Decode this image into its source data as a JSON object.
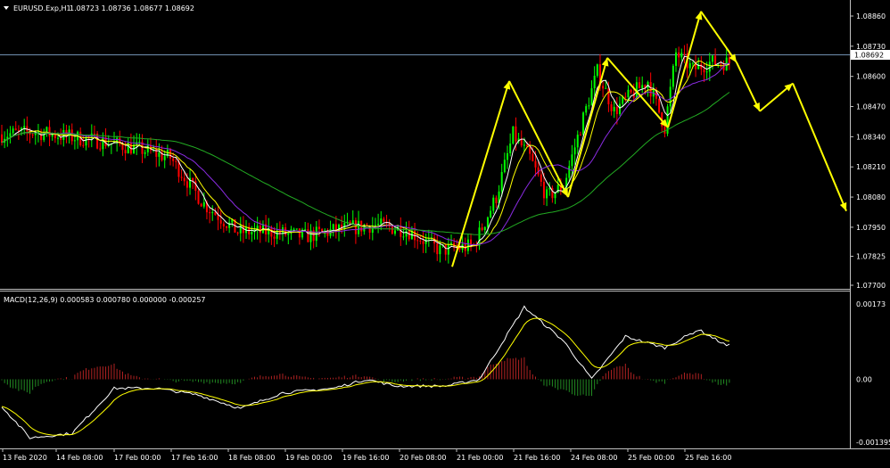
{
  "main_panel": {
    "header_symbol": "EURUSD.Exp,H1",
    "header_ohlc": "1.08723 1.08736 1.08677 1.08692"
  },
  "macd_panel": {
    "header": "MACD(12,26,9) 0.000583 0.000780 0.000000 -0.000257"
  },
  "colors": {
    "background": "#000000",
    "bull_candle": "#00ff00",
    "bear_candle": "#ff0000",
    "grid_border": "#c0c0c0",
    "price_line": "#6f8faf",
    "ma_fast": "#ffffff",
    "ma_mid": "#ffff00",
    "ma_slow": "#8a2be2",
    "ma_long": "#22aa22",
    "projection": "#ffff00",
    "macd_line": "#ffffff",
    "signal_line": "#ffff00",
    "hist_pos": "#b22222",
    "hist_neg": "#228b22"
  },
  "chart_data": [
    {
      "type": "candlestick",
      "symbol": "EURUSD.Exp",
      "timeframe": "H1",
      "y_axis_ticks": [
        "1.08860",
        "1.08730",
        "1.08600",
        "1.08470",
        "1.08340",
        "1.08210",
        "1.08080",
        "1.07950",
        "1.07825",
        "1.07700"
      ],
      "ylim": [
        1.077,
        1.0892
      ],
      "current_price": "1.08692",
      "x_axis_ticks": [
        "13 Feb 2020",
        "14 Feb 08:00",
        "17 Feb 00:00",
        "17 Feb 16:00",
        "18 Feb 08:00",
        "19 Feb 00:00",
        "19 Feb 16:00",
        "20 Feb 08:00",
        "21 Feb 00:00",
        "21 Feb 16:00",
        "24 Feb 08:00",
        "25 Feb 00:00",
        "25 Feb 16:00"
      ],
      "approx_close_path": [
        [
          0,
          1.0835
        ],
        [
          12,
          1.0836
        ],
        [
          24,
          1.0834
        ],
        [
          36,
          1.0832
        ],
        [
          48,
          1.0829
        ],
        [
          60,
          1.0825
        ],
        [
          72,
          1.0805
        ],
        [
          84,
          1.0793
        ],
        [
          96,
          1.0793
        ],
        [
          108,
          1.0791
        ],
        [
          120,
          1.0794
        ],
        [
          132,
          1.0796
        ],
        [
          144,
          1.0794
        ],
        [
          156,
          1.0785
        ],
        [
          168,
          1.0787
        ],
        [
          176,
          1.0808
        ],
        [
          182,
          1.0835
        ],
        [
          188,
          1.0825
        ],
        [
          194,
          1.0808
        ],
        [
          200,
          1.0813
        ],
        [
          206,
          1.0838
        ],
        [
          212,
          1.0862
        ],
        [
          218,
          1.0845
        ],
        [
          224,
          1.0852
        ],
        [
          230,
          1.0858
        ],
        [
          236,
          1.0838
        ],
        [
          240,
          1.087
        ],
        [
          246,
          1.0863
        ],
        [
          252,
          1.0866
        ]
      ],
      "projection_arrows": [
        [
          1.0778,
          1.0858
        ],
        [
          1.0858,
          1.0808
        ],
        [
          1.0808,
          1.0868
        ],
        [
          1.0868,
          1.0838
        ],
        [
          1.0838,
          1.0864
        ],
        [
          1.0864,
          1.0834
        ],
        [
          1.0834,
          1.0888
        ],
        [
          1.0888,
          1.0866
        ],
        [
          1.0866,
          1.0845
        ],
        [
          1.0845,
          1.0857
        ],
        [
          1.0857,
          1.0802
        ]
      ]
    },
    {
      "type": "line+bar",
      "indicator": "MACD(12,26,9)",
      "y_axis_ticks": [
        "0.00173",
        "0.00",
        "-0.001395"
      ],
      "ylim": [
        -0.001395,
        0.00173
      ]
    }
  ]
}
